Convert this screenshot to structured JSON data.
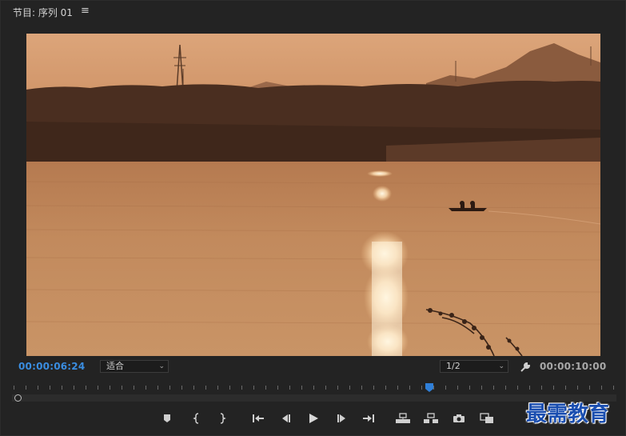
{
  "panel": {
    "title": "节目: 序列 01",
    "menu_icon": "hamburger-menu-icon"
  },
  "viewer": {
    "current_timecode": "00:00:06:24",
    "duration_timecode": "00:00:10:00",
    "zoom_select": "适合",
    "resolution_select": "1/2",
    "settings_icon": "wrench-icon",
    "playhead_position_fraction": 0.69
  },
  "transport": {
    "buttons": [
      {
        "name": "add-marker-button",
        "icon": "marker-icon"
      },
      {
        "name": "mark-in-button",
        "icon": "mark-in-icon"
      },
      {
        "name": "mark-out-button",
        "icon": "mark-out-icon"
      },
      {
        "name": "go-to-in-button",
        "icon": "go-to-in-icon"
      },
      {
        "name": "step-back-button",
        "icon": "step-back-icon"
      },
      {
        "name": "play-button",
        "icon": "play-icon"
      },
      {
        "name": "step-forward-button",
        "icon": "step-forward-icon"
      },
      {
        "name": "go-to-out-button",
        "icon": "go-to-out-icon"
      },
      {
        "name": "lift-button",
        "icon": "lift-icon"
      },
      {
        "name": "extract-button",
        "icon": "extract-icon"
      },
      {
        "name": "export-frame-button",
        "icon": "camera-icon"
      },
      {
        "name": "compare-view-button",
        "icon": "compare-icon"
      }
    ]
  },
  "colors": {
    "timecode_accent": "#3a8de0",
    "playhead": "#2f7fd8",
    "background": "#232323"
  },
  "watermark": "最需教育"
}
